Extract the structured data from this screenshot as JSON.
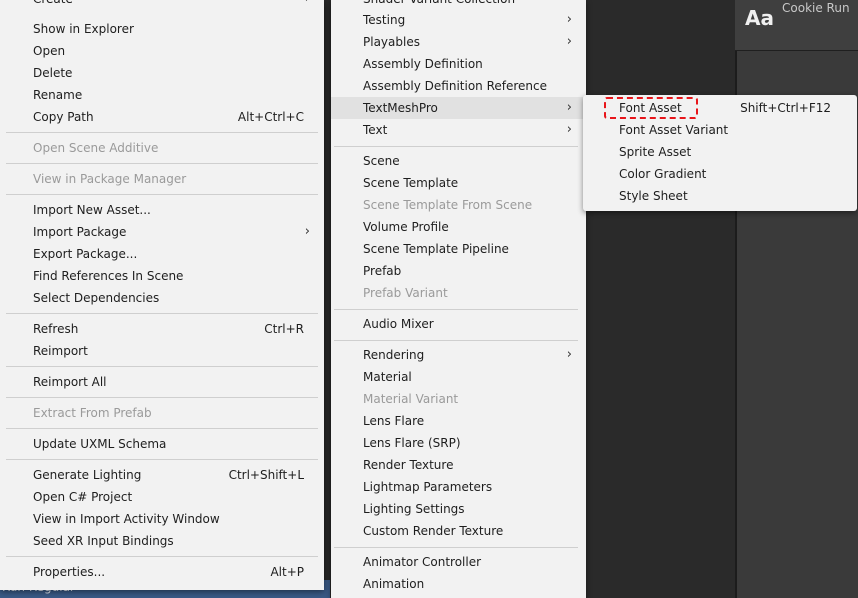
{
  "right_panel": {
    "preview_text": "Aa",
    "font_name": "Cookie Run"
  },
  "bottom_label": "Run Regular",
  "menu1": {
    "items": [
      {
        "label": "Create",
        "shortcut": "",
        "arrow": true,
        "disabled": false
      },
      {
        "label": "Show in Explorer",
        "shortcut": "",
        "arrow": false,
        "disabled": false
      },
      {
        "label": "Open",
        "shortcut": "",
        "arrow": false,
        "disabled": false
      },
      {
        "label": "Delete",
        "shortcut": "",
        "arrow": false,
        "disabled": false
      },
      {
        "label": "Rename",
        "shortcut": "",
        "arrow": false,
        "disabled": false
      },
      {
        "label": "Copy Path",
        "shortcut": "Alt+Ctrl+C",
        "arrow": false,
        "disabled": false
      },
      {
        "label": "Open Scene Additive",
        "shortcut": "",
        "arrow": false,
        "disabled": true
      },
      {
        "label": "View in Package Manager",
        "shortcut": "",
        "arrow": false,
        "disabled": true
      },
      {
        "label": "Import New Asset...",
        "shortcut": "",
        "arrow": false,
        "disabled": false
      },
      {
        "label": "Import Package",
        "shortcut": "",
        "arrow": true,
        "disabled": false
      },
      {
        "label": "Export Package...",
        "shortcut": "",
        "arrow": false,
        "disabled": false
      },
      {
        "label": "Find References In Scene",
        "shortcut": "",
        "arrow": false,
        "disabled": false
      },
      {
        "label": "Select Dependencies",
        "shortcut": "",
        "arrow": false,
        "disabled": false
      },
      {
        "label": "Refresh",
        "shortcut": "Ctrl+R",
        "arrow": false,
        "disabled": false
      },
      {
        "label": "Reimport",
        "shortcut": "",
        "arrow": false,
        "disabled": false
      },
      {
        "label": "Reimport All",
        "shortcut": "",
        "arrow": false,
        "disabled": false
      },
      {
        "label": "Extract From Prefab",
        "shortcut": "",
        "arrow": false,
        "disabled": true
      },
      {
        "label": "Update UXML Schema",
        "shortcut": "",
        "arrow": false,
        "disabled": false
      },
      {
        "label": "Generate Lighting",
        "shortcut": "Ctrl+Shift+L",
        "arrow": false,
        "disabled": false
      },
      {
        "label": "Open C# Project",
        "shortcut": "",
        "arrow": false,
        "disabled": false
      },
      {
        "label": "View in Import Activity Window",
        "shortcut": "",
        "arrow": false,
        "disabled": false
      },
      {
        "label": "Seed XR Input Bindings",
        "shortcut": "",
        "arrow": false,
        "disabled": false
      },
      {
        "label": "Properties...",
        "shortcut": "Alt+P",
        "arrow": false,
        "disabled": false
      }
    ]
  },
  "menu2": {
    "items": [
      {
        "label": "Shader Variant Collection",
        "arrow": false,
        "disabled": false
      },
      {
        "label": "Testing",
        "arrow": true,
        "disabled": false
      },
      {
        "label": "Playables",
        "arrow": true,
        "disabled": false
      },
      {
        "label": "Assembly Definition",
        "arrow": false,
        "disabled": false
      },
      {
        "label": "Assembly Definition Reference",
        "arrow": false,
        "disabled": false
      },
      {
        "label": "TextMeshPro",
        "arrow": true,
        "disabled": false,
        "highlight": true
      },
      {
        "label": "Text",
        "arrow": true,
        "disabled": false
      },
      {
        "label": "Scene",
        "arrow": false,
        "disabled": false
      },
      {
        "label": "Scene Template",
        "arrow": false,
        "disabled": false
      },
      {
        "label": "Scene Template From Scene",
        "arrow": false,
        "disabled": true
      },
      {
        "label": "Volume Profile",
        "arrow": false,
        "disabled": false
      },
      {
        "label": "Scene Template Pipeline",
        "arrow": false,
        "disabled": false
      },
      {
        "label": "Prefab",
        "arrow": false,
        "disabled": false
      },
      {
        "label": "Prefab Variant",
        "arrow": false,
        "disabled": true
      },
      {
        "label": "Audio Mixer",
        "arrow": false,
        "disabled": false
      },
      {
        "label": "Rendering",
        "arrow": true,
        "disabled": false
      },
      {
        "label": "Material",
        "arrow": false,
        "disabled": false
      },
      {
        "label": "Material Variant",
        "arrow": false,
        "disabled": true
      },
      {
        "label": "Lens Flare",
        "arrow": false,
        "disabled": false
      },
      {
        "label": "Lens Flare (SRP)",
        "arrow": false,
        "disabled": false
      },
      {
        "label": "Render Texture",
        "arrow": false,
        "disabled": false
      },
      {
        "label": "Lightmap Parameters",
        "arrow": false,
        "disabled": false
      },
      {
        "label": "Lighting Settings",
        "arrow": false,
        "disabled": false
      },
      {
        "label": "Custom Render Texture",
        "arrow": false,
        "disabled": false
      },
      {
        "label": "Animator Controller",
        "arrow": false,
        "disabled": false
      },
      {
        "label": "Animation",
        "arrow": false,
        "disabled": false
      }
    ]
  },
  "menu3": {
    "items": [
      {
        "label": "Font Asset",
        "shortcut": "Shift+Ctrl+F12"
      },
      {
        "label": "Font Asset Variant",
        "shortcut": ""
      },
      {
        "label": "Sprite Asset",
        "shortcut": ""
      },
      {
        "label": "Color Gradient",
        "shortcut": ""
      },
      {
        "label": "Style Sheet",
        "shortcut": ""
      }
    ]
  },
  "icons": {
    "submenu_arrow": "chevron-right-icon"
  }
}
